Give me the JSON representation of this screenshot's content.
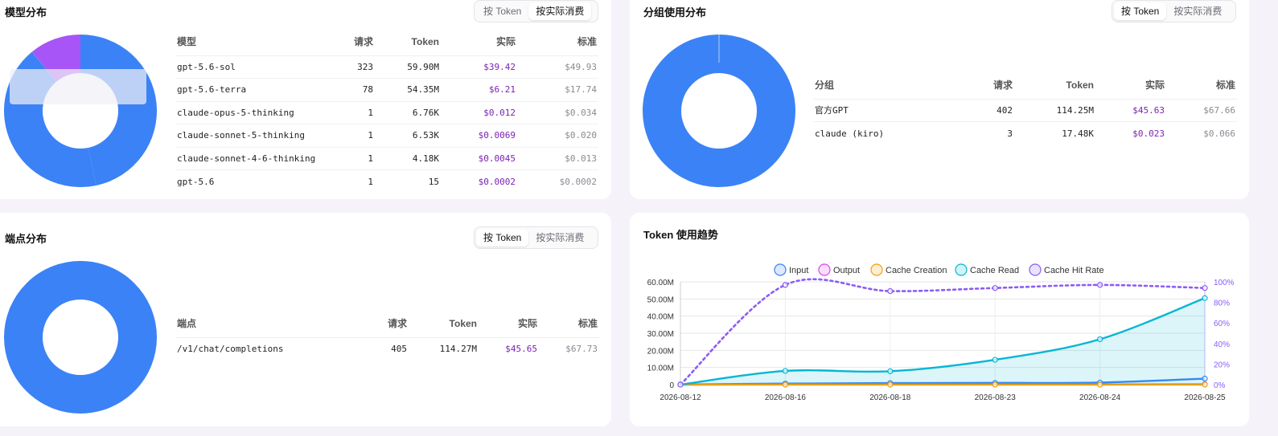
{
  "model_card": {
    "title": "模型分布",
    "toggle": {
      "by_token": "按 Token",
      "by_cost": "按实际消费"
    },
    "donut": {
      "slices": [
        {
          "value": 59.9,
          "color": "#3b82f6"
        },
        {
          "value": 54.35,
          "color": "#3b82f6"
        },
        {
          "value": 0.03,
          "color": "#3b82f6"
        },
        {
          "value": 0.01,
          "color": "#a855f7"
        },
        {
          "value": 14.0,
          "color": "#a855f7"
        }
      ]
    },
    "headers": {
      "name": "模型",
      "req": "请求",
      "token": "Token",
      "actual": "实际",
      "std": "标准"
    },
    "rows": [
      {
        "name": "gpt-5.6-sol",
        "req": "323",
        "token": "59.90M",
        "actual": "$39.42",
        "std": "$49.93"
      },
      {
        "name": "gpt-5.6-terra",
        "req": "78",
        "token": "54.35M",
        "actual": "$6.21",
        "std": "$17.74"
      },
      {
        "name": "claude-opus-5-thinking",
        "req": "1",
        "token": "6.76K",
        "actual": "$0.012",
        "std": "$0.034"
      },
      {
        "name": "claude-sonnet-5-thinking",
        "req": "1",
        "token": "6.53K",
        "actual": "$0.0069",
        "std": "$0.020"
      },
      {
        "name": "claude-sonnet-4-6-thinking",
        "req": "1",
        "token": "4.18K",
        "actual": "$0.0045",
        "std": "$0.013"
      },
      {
        "name": "gpt-5.6",
        "req": "1",
        "token": "15",
        "actual": "$0.0002",
        "std": "$0.0002"
      }
    ]
  },
  "group_card": {
    "title": "分组使用分布",
    "toggle": {
      "by_token": "按 Token",
      "by_cost": "按实际消费"
    },
    "headers": {
      "name": "分组",
      "req": "请求",
      "token": "Token",
      "actual": "实际",
      "std": "标准"
    },
    "rows": [
      {
        "name": "官方GPT",
        "req": "402",
        "token": "114.25M",
        "actual": "$45.63",
        "std": "$67.66"
      },
      {
        "name": "claude (kiro)",
        "req": "3",
        "token": "17.48K",
        "actual": "$0.023",
        "std": "$0.066"
      }
    ]
  },
  "endpoint_card": {
    "title": "端点分布",
    "toggle": {
      "by_token": "按 Token",
      "by_cost": "按实际消费"
    },
    "headers": {
      "name": "端点",
      "req": "请求",
      "token": "Token",
      "actual": "实际",
      "std": "标准"
    },
    "rows": [
      {
        "name": "/v1/chat/completions",
        "req": "405",
        "token": "114.27M",
        "actual": "$45.65",
        "std": "$67.73"
      }
    ]
  },
  "trend_card": {
    "title": "Token 使用趋势"
  },
  "chart_data": {
    "type": "line",
    "x": [
      "2026-08-12",
      "2026-08-16",
      "2026-08-18",
      "2026-08-23",
      "2026-08-24",
      "2026-08-25"
    ],
    "y_left": {
      "ticks": [
        "0",
        "10.00M",
        "20.00M",
        "30.00M",
        "40.00M",
        "50.00M",
        "60.00M"
      ],
      "range": [
        0,
        60
      ]
    },
    "y_right": {
      "ticks": [
        "0%",
        "20%",
        "40%",
        "60%",
        "80%",
        "100%"
      ],
      "range": [
        0,
        100
      ]
    },
    "series": [
      {
        "name": "Input",
        "axis": "left",
        "color": "#3b82f6",
        "values": [
          0.1,
          0.6,
          0.9,
          1.0,
          1.2,
          3.5
        ]
      },
      {
        "name": "Output",
        "axis": "left",
        "color": "#d946ef",
        "values": [
          0.0,
          0.1,
          0.1,
          0.1,
          0.1,
          0.2
        ]
      },
      {
        "name": "Cache Creation",
        "axis": "left",
        "color": "#f59e0b",
        "values": [
          0.0,
          0.0,
          0.0,
          0.0,
          0.0,
          0.0
        ]
      },
      {
        "name": "Cache Read",
        "axis": "left",
        "color": "#06b6d4",
        "values": [
          0.0,
          8.0,
          7.8,
          14.5,
          26.5,
          50.5
        ],
        "fill": true
      },
      {
        "name": "Cache Hit Rate",
        "axis": "right",
        "color": "#8b5cf6",
        "values": [
          0,
          97,
          91,
          94,
          97,
          94
        ],
        "dashed": true
      }
    ],
    "grid": true,
    "legend": "top-center"
  }
}
